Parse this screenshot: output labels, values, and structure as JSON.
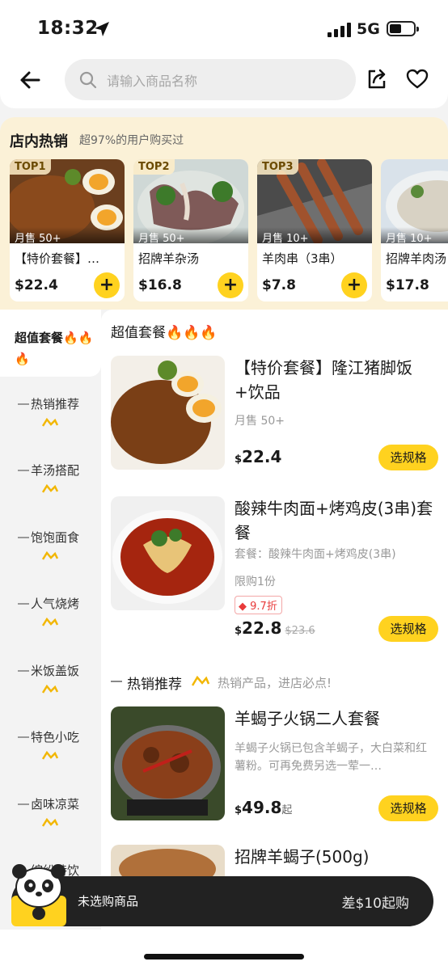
{
  "status_bar": {
    "time": "18:32",
    "network": "5G"
  },
  "search": {
    "placeholder": "请输入商品名称"
  },
  "hot_section": {
    "title": "店内热销",
    "subtitle": "超97%的用户购买过",
    "cards": [
      {
        "rank": "TOP1",
        "sold": "月售 50+",
        "name": "【特价套餐】…",
        "price": "$22.4"
      },
      {
        "rank": "TOP2",
        "sold": "月售 50+",
        "name": "招牌羊杂汤",
        "price": "$16.8"
      },
      {
        "rank": "TOP3",
        "sold": "月售 10+",
        "name": "羊肉串（3串）",
        "price": "$7.8"
      },
      {
        "rank": "",
        "sold": "月售 10+",
        "name": "招牌羊肉汤",
        "price": "$17.8"
      }
    ]
  },
  "sidebar": {
    "active": "超值套餐🔥🔥🔥",
    "items": [
      "热销推荐",
      "羊汤搭配",
      "饱饱面食",
      "人气烧烤",
      "米饭盖饭",
      "特色小吃",
      "卤味凉菜",
      "缤纷特饮"
    ]
  },
  "menu": {
    "section1": "超值套餐🔥🔥🔥",
    "section2_title": "热销推荐",
    "section2_sub": "热销产品，进店必点!",
    "items": [
      {
        "name": "【特价套餐】隆江猪脚饭+饮品",
        "desc": "月售 50+",
        "price": "22.4",
        "currency": "$",
        "button": "选规格"
      },
      {
        "name": "酸辣牛肉面+烤鸡皮(3串)套餐",
        "desc": "套餐：酸辣牛肉面+烤鸡皮(3串)",
        "limit": "限购1份",
        "discount": "9.7折",
        "price": "22.8",
        "currency": "$",
        "original": "$23.6",
        "button": "选规格"
      },
      {
        "name": "羊蝎子火锅二人套餐",
        "desc": "羊蝎子火锅已包含羊蝎子，大白菜和红薯粉。可再免费另选一荤一…",
        "price": "49.8",
        "currency": "$",
        "suffix": "起",
        "button": "选规格"
      },
      {
        "name": "招牌羊蝎子(500g)"
      }
    ]
  },
  "cart": {
    "label": "未选购商品",
    "min_order": "差$10起购"
  },
  "colors": {
    "accent": "#ffd21f",
    "hot_bg": "#fbf1d7",
    "cart_bg": "#222222",
    "discount": "#e83a3a"
  }
}
